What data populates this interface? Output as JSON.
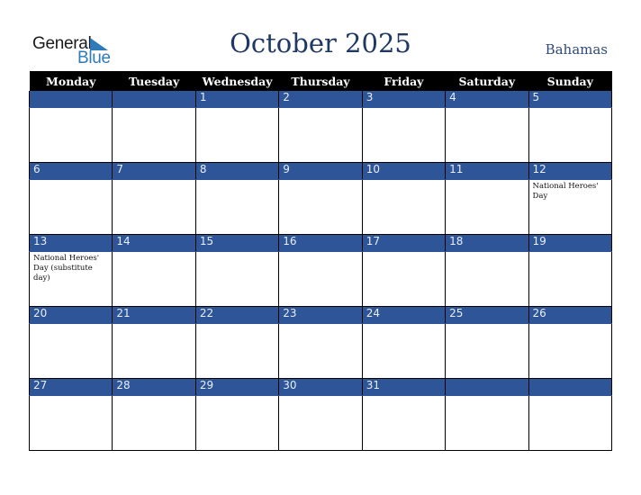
{
  "logo": {
    "line1": "General",
    "line2": "Blue"
  },
  "header": {
    "title": "October 2025",
    "country": "Bahamas"
  },
  "weekdays": [
    "Monday",
    "Tuesday",
    "Wednesday",
    "Thursday",
    "Friday",
    "Saturday",
    "Sunday"
  ],
  "weeks": [
    {
      "days": [
        "",
        "",
        "1",
        "2",
        "3",
        "4",
        "5"
      ],
      "events": [
        "",
        "",
        "",
        "",
        "",
        "",
        ""
      ]
    },
    {
      "days": [
        "6",
        "7",
        "8",
        "9",
        "10",
        "11",
        "12"
      ],
      "events": [
        "",
        "",
        "",
        "",
        "",
        "",
        "National Heroes' Day"
      ]
    },
    {
      "days": [
        "13",
        "14",
        "15",
        "16",
        "17",
        "18",
        "19"
      ],
      "events": [
        "National Heroes' Day (substitute day)",
        "",
        "",
        "",
        "",
        "",
        ""
      ]
    },
    {
      "days": [
        "20",
        "21",
        "22",
        "23",
        "24",
        "25",
        "26"
      ],
      "events": [
        "",
        "",
        "",
        "",
        "",
        "",
        ""
      ]
    },
    {
      "days": [
        "27",
        "28",
        "29",
        "30",
        "31",
        "",
        ""
      ],
      "events": [
        "",
        "",
        "",
        "",
        "",
        "",
        ""
      ]
    }
  ],
  "colors": {
    "band": "#2e5597",
    "header_bg": "#000000",
    "title": "#1f3864",
    "logo_blue": "#2f7ab8"
  }
}
